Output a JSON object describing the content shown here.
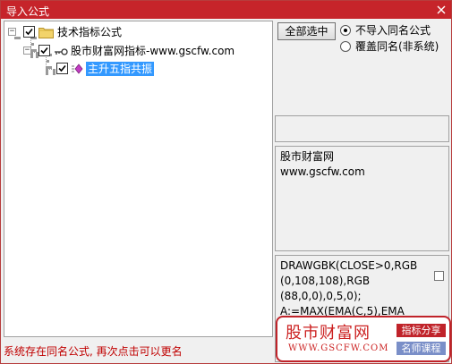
{
  "window": {
    "title": "导入公式"
  },
  "tree": {
    "root_label": "技术指标公式",
    "child_label": "股市财富网指标-www.gscfw.com",
    "leaf_label": "主升五指共振"
  },
  "right_panel": {
    "select_all_label": "全部选中",
    "options": [
      {
        "label": "不导入同名公式",
        "selected": true
      },
      {
        "label": "覆盖同名(非系统)",
        "selected": false
      }
    ],
    "info_lines": [
      "股市财富网",
      "www.gscfw.com"
    ],
    "code_lines": [
      "DRAWGBK(CLOSE>0,RGB",
      "(0,108,108),RGB",
      "(88,0,0),0,5,0);",
      "A:=MAX(EMA(C,5),EMA"
    ]
  },
  "status": "系统存在同名公式, 再次点击可以更名",
  "watermark": {
    "site_name": "股市财富网",
    "site_url": "WWW.GSCFW.COM",
    "tag_1": "指标分享",
    "tag_2": "名师课程"
  },
  "colors": {
    "title_bar": "#c6242a",
    "selection": "#3399ff",
    "status_text": "#c00000"
  }
}
